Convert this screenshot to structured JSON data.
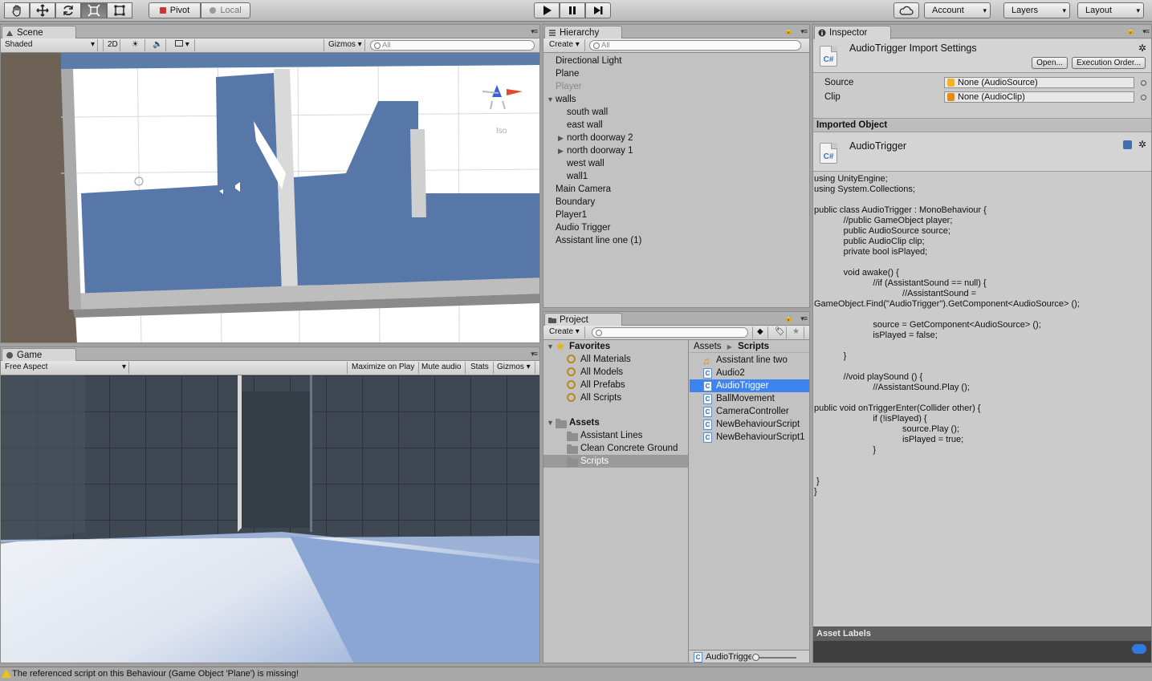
{
  "toolbar": {
    "tools": [
      "hand-tool-icon",
      "move-tool-icon",
      "rotate-tool-icon",
      "scale-tool-icon",
      "rect-tool-icon"
    ],
    "pivot": "Pivot",
    "local": "Local",
    "account": "Account",
    "layers": "Layers",
    "layout": "Layout"
  },
  "scene": {
    "tab": "Scene",
    "shading": "Shaded",
    "mode2d": "2D",
    "gizmos": "Gizmos",
    "search_placeholder": "All",
    "iso_label": "Iso"
  },
  "game": {
    "tab": "Game",
    "aspect": "Free Aspect",
    "maximize": "Maximize on Play",
    "mute": "Mute audio",
    "stats": "Stats",
    "gizmos": "Gizmos"
  },
  "hierarchy": {
    "tab": "Hierarchy",
    "create": "Create",
    "search_placeholder": "All",
    "items": [
      {
        "label": "Directional Light"
      },
      {
        "label": "Plane"
      },
      {
        "label": "Player"
      },
      {
        "label": "walls"
      },
      {
        "label": "south wall"
      },
      {
        "label": "east wall"
      },
      {
        "label": "north doorway 2"
      },
      {
        "label": "north doorway 1"
      },
      {
        "label": "west wall"
      },
      {
        "label": "wall1"
      },
      {
        "label": "Main Camera"
      },
      {
        "label": "Boundary"
      },
      {
        "label": "Player1"
      },
      {
        "label": "Audio Trigger"
      },
      {
        "label": "Assistant line one (1)"
      }
    ]
  },
  "project": {
    "tab": "Project",
    "create": "Create",
    "favorites": "Favorites",
    "fav_items": [
      "All Materials",
      "All Models",
      "All Prefabs",
      "All Scripts"
    ],
    "assets": "Assets",
    "asset_folders": [
      "Assistant Lines",
      "Clean Concrete Ground",
      "Scripts"
    ],
    "breadcrumb": [
      "Assets",
      "Scripts"
    ],
    "files": [
      "Assistant line two",
      "Audio2",
      "AudioTrigger",
      "BallMovement",
      "CameraController",
      "NewBehaviourScript",
      "NewBehaviourScript1"
    ],
    "footer_file": "AudioTrigger"
  },
  "inspector": {
    "tab": "Inspector",
    "title": "AudioTrigger Import Settings",
    "open": "Open...",
    "exec_order": "Execution Order...",
    "source_label": "Source",
    "source_value": "None (AudioSource)",
    "clip_label": "Clip",
    "clip_value": "None (AudioClip)",
    "imported_header": "Imported Object",
    "imported_name": "AudioTrigger",
    "code": "using UnityEngine;\nusing System.Collections;\n\npublic class AudioTrigger : MonoBehaviour {\n            //public GameObject player;\n            public AudioSource source;\n            public AudioClip clip;\n            private bool isPlayed;\n\n            void awake() {\n                        //if (AssistantSound == null) {\n                                    //AssistantSound =\nGameObject.Find(\"AudioTrigger\").GetComponent<AudioSource> ();\n\n                        source = GetComponent<AudioSource> ();\n                        isPlayed = false;\n\n            }\n\n            //void playSound () {\n                        //AssistantSound.Play ();\n\npublic void onTriggerEnter(Collider other) {\n                        if (!isPlayed) {\n                                    source.Play ();\n                                    isPlayed = true;\n                        }\n\n\n }\n}",
    "asset_labels": "Asset Labels"
  },
  "status": {
    "message": "The referenced script on this Behaviour (Game Object 'Plane') is missing!"
  }
}
